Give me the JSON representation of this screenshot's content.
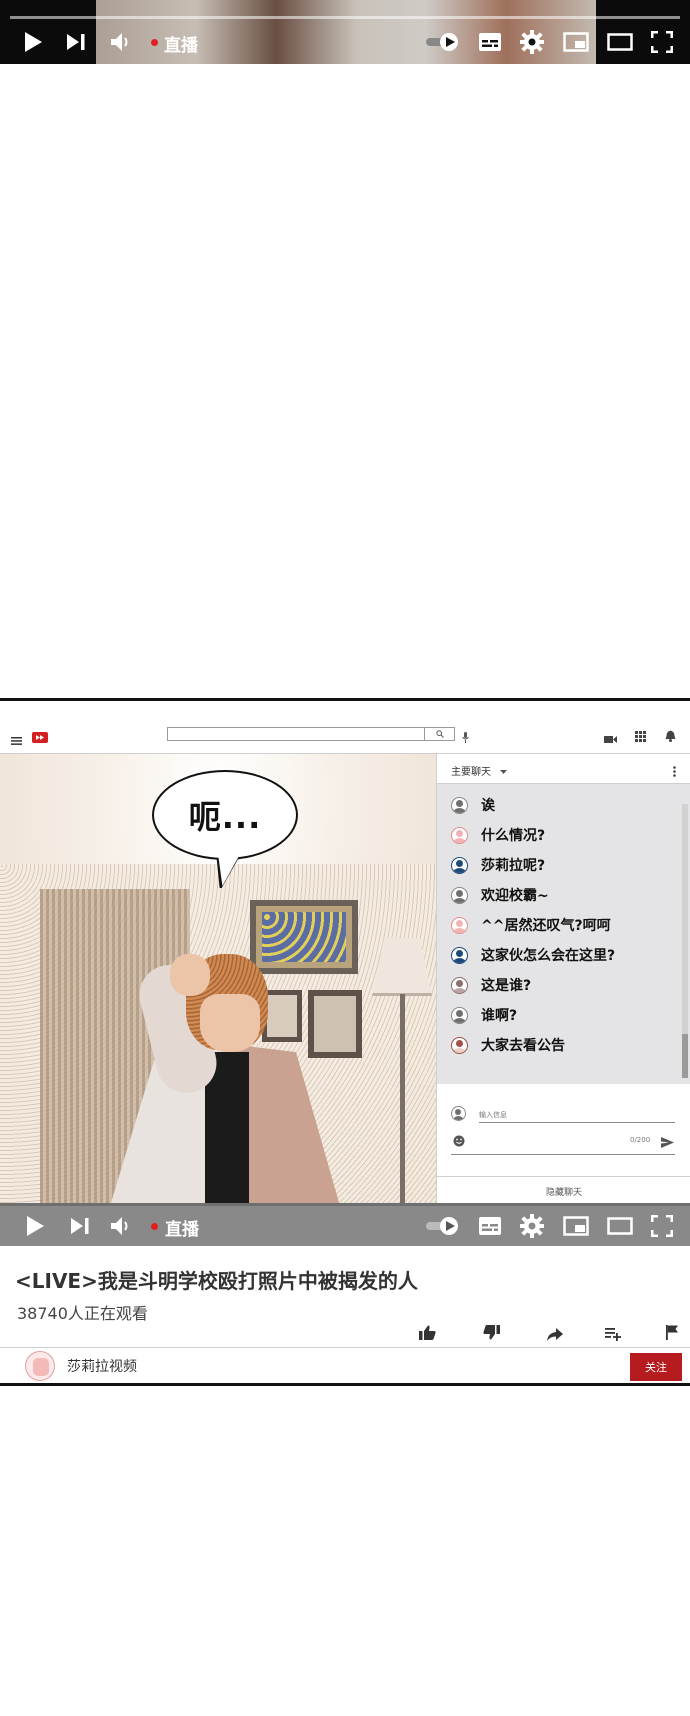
{
  "top_player": {
    "live_label": "直播"
  },
  "header": {
    "search_placeholder": ""
  },
  "speech_bubble": {
    "text": "呃..."
  },
  "chat": {
    "title": "主要聊天",
    "messages": [
      {
        "text": "诶",
        "avatar_color": "#6f6f6f"
      },
      {
        "text": "什么情况?",
        "avatar_color": "#e58c8c"
      },
      {
        "text": "莎莉拉呢?",
        "avatar_color": "#1e4a7a"
      },
      {
        "text": "欢迎校霸~",
        "avatar_color": "#6f6f6f"
      },
      {
        "text": "^^居然还叹气?呵呵",
        "avatar_color": "#e58c8c"
      },
      {
        "text": "这家伙怎么会在这里?",
        "avatar_color": "#1e4a7a"
      },
      {
        "text": "这是谁?",
        "avatar_color": "#8b6f6f"
      },
      {
        "text": "谁啊?",
        "avatar_color": "#6f6f6f"
      },
      {
        "text": "大家去看公告",
        "avatar_color": "#a0524a"
      }
    ],
    "input_placeholder": "输入信息",
    "char_count": "0/200",
    "hide_label": "隐藏聊天"
  },
  "player": {
    "live_label": "直播"
  },
  "video": {
    "title": "<LIVE>我是斗明学校殴打照片中被揭发的人",
    "viewers": "38740人正在观看"
  },
  "channel": {
    "name": "莎莉拉视频",
    "follow_label": "关注"
  },
  "colors": {
    "live_red": "#e02020",
    "follow_red": "#b51b1f",
    "chat_bg": "#e4e4e6",
    "player_bar": "#898989"
  }
}
